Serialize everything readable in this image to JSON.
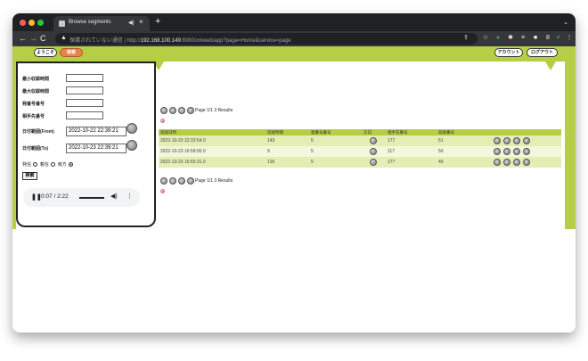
{
  "browser": {
    "tab_title": "Browse segments",
    "tab_audio_icon": "speaker-icon",
    "tab_close": "×",
    "new_tab": "+",
    "tab_menu": "⌄",
    "security_label": "保護されていない通信",
    "url_scheme": "http://",
    "url_host": "192.168.100.149",
    "url_rest": ":8080/orkweb/app?page=Home&service=page",
    "colors": {
      "titlebar": "#202124",
      "toolbar": "#35363a"
    }
  },
  "header": {
    "welcome_btn": "ようこそ",
    "orange_btn": "検索",
    "account_btn": "アカウント",
    "logout_btn": "ログアウト",
    "accent_color": "#b4ce46"
  },
  "search_form": {
    "min_duration_label": "最小収録時間",
    "max_duration_label": "最大収録時間",
    "caller_label": "発番号番号",
    "callee_label": "相手先番号",
    "date_from_label": "日付範囲(From)",
    "date_from_value": "2022-10-22 22:39:21",
    "date_to_label": "日付範囲(To)",
    "date_to_value": "2022-10-23 22:39:21",
    "direction_out": "発信",
    "direction_in": "着信",
    "direction_both": "両方",
    "search_button": "検索"
  },
  "audio_player": {
    "time": "0:07 / 2:22",
    "progress": 0.05
  },
  "results": {
    "pager_top": "Page 1/1 3 Results",
    "pager_bottom": "Page 1/1 3 Results",
    "columns": [
      "収録日時",
      "収録時間",
      "発番号番号",
      "方向",
      "相手先番号",
      "収録番号",
      ""
    ],
    "rows": [
      {
        "date": "2022-10-23 22:33:54.0",
        "duration": "143",
        "local": "5",
        "remote": "177",
        "recno": "51"
      },
      {
        "date": "2022-10-23 16:58:00.0",
        "duration": "9",
        "local": "5",
        "remote": "117",
        "recno": "50"
      },
      {
        "date": "2022-10-23 16:55:31.0",
        "duration": "136",
        "local": "5",
        "remote": "177",
        "recno": "49"
      }
    ]
  }
}
